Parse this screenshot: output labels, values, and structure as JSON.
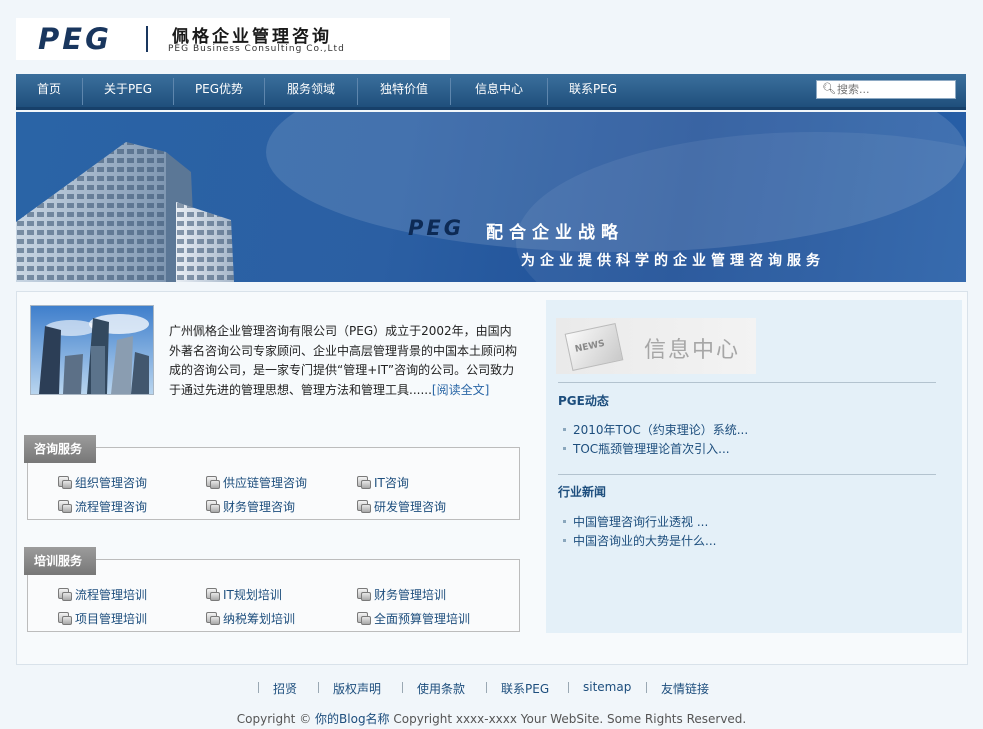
{
  "header": {
    "logo_mark": "PEG",
    "logo_cn": "佩格企业管理咨询",
    "logo_en": "PEG Business Consulting Co.,Ltd"
  },
  "nav": {
    "items": [
      "首页",
      "关于PEG",
      "PEG优势",
      "服务领域",
      "独特价值",
      "信息中心",
      "联系PEG"
    ],
    "search_placeholder": "搜索..."
  },
  "banner": {
    "mark": "PEG",
    "line1": "配合企业战略",
    "line2": "为企业提供科学的企业管理咨询服务"
  },
  "intro": {
    "text": "广州佩格企业管理咨询有限公司（PEG）成立于2002年，由国内外著名咨询公司专家顾问、企业中高层管理背景的中国本土顾问构成的咨询公司，是一家专门提供“管理+IT”咨询的公司。公司致力于通过先进的管理思想、管理方法和管理工具......",
    "read_more": "[阅读全文]"
  },
  "consulting": {
    "title": "咨询服务",
    "items": [
      "组织管理咨询",
      "供应链管理咨询",
      "IT咨询",
      "流程管理咨询",
      "财务管理咨询",
      "研发管理咨询"
    ]
  },
  "training": {
    "title": "培训服务",
    "items": [
      "流程管理培训",
      "IT规划培训",
      "财务管理培训",
      "项目管理培训",
      "纳税筹划培训",
      "全面预算管理培训"
    ]
  },
  "news_center": {
    "title": "信息中心",
    "badge": "NEWS",
    "sections": [
      {
        "title": "PGE动态",
        "items": [
          "2010年TOC（约束理论）系统...",
          "TOC瓶颈管理理论首次引入..."
        ]
      },
      {
        "title": "行业新闻",
        "items": [
          "中国管理咨询行业透视 ...",
          "中国咨询业的大势是什么..."
        ]
      }
    ]
  },
  "footer": {
    "links": [
      "招贤",
      "版权声明",
      "使用条款",
      "联系PEG",
      "sitemap",
      "友情链接"
    ],
    "copyright_prefix": "Copyright ©",
    "blog_name": "你的Blog名称",
    "copyright_suffix": "Copyright xxxx-xxxx Your WebSite. Some Rights Reserved."
  },
  "colors": {
    "nav_bg": "#2b5f8d",
    "link": "#1d4e7d",
    "banner": "#2a62a6"
  }
}
